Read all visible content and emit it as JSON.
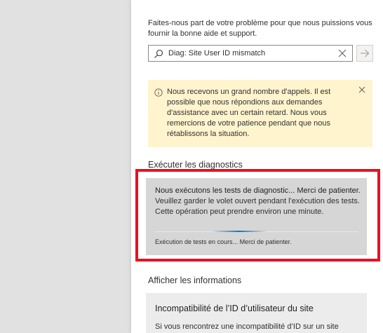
{
  "intro_text": "Faites-nous part de votre problème pour que nous puissions vous fournir la bonne aide et support.",
  "search": {
    "value": "Diag: Site User ID mismatch"
  },
  "notice": "Nous recevons un grand nombre d'appels. Il est possible que nous répondions aux demandes d'assistance avec un certain retard. Nous vous remercions de votre patience pendant que nous rétablissons la situation.",
  "diagnostics": {
    "heading": "Exécuter les diagnostics",
    "title": "Nous exécutons les tests de diagnostic... Merci de patienter.",
    "body": "Veuillez garder le volet ouvert pendant l'exécution des tests. Cette opération peut prendre environ une minute.",
    "progress_status": "Exécution de tests en cours... Merci de patienter."
  },
  "information": {
    "heading": "Afficher les informations",
    "card_title": "Incompatibilité de l’ID d’utilisateur du site",
    "card_body": "Si vous rencontrez une incompatibilité d’ID sur un site"
  },
  "colors": {
    "highlight": "#e81123",
    "warning_bg": "#fff4ce",
    "accent": "#0078d4"
  },
  "icons": {
    "search": "search-icon",
    "clear": "close-icon",
    "submit": "arrow-right-icon",
    "info": "info-icon",
    "dismiss": "close-icon"
  }
}
